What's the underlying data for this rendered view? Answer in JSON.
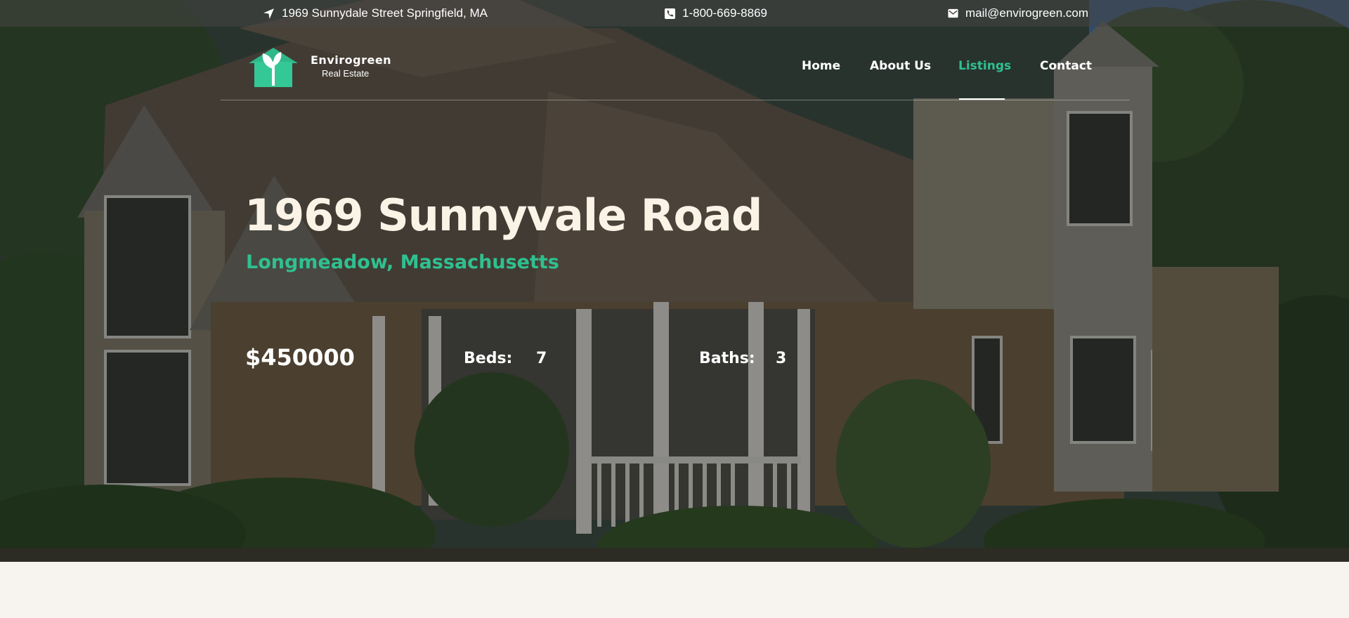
{
  "topbar": {
    "address": "1969 Sunnydale Street Springfield, MA",
    "phone": "1-800-669-8869",
    "email": "mail@envirogreen.com",
    "icons": [
      "location-arrow-icon",
      "phone-icon",
      "envelope-icon"
    ]
  },
  "logo": {
    "name": "Envirogreen",
    "subtitle": "Real Estate"
  },
  "nav": {
    "items": [
      {
        "label": "Home",
        "active": false
      },
      {
        "label": "About Us",
        "active": false
      },
      {
        "label": "Listings",
        "active": true
      },
      {
        "label": "Contact",
        "active": false
      }
    ]
  },
  "listing": {
    "title": "1969 Sunnyvale Road",
    "location": "Longmeadow, Massachusetts",
    "price": "$450000",
    "beds_label": "Beds:",
    "beds": "7",
    "baths_label": "Baths:",
    "baths": "3"
  },
  "colors": {
    "accent": "#2fc090",
    "title_text": "#faf3e6",
    "page_bg": "#f7f3ee"
  }
}
